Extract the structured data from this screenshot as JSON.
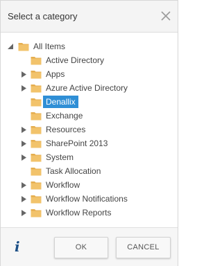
{
  "dialog": {
    "title": "Select a category"
  },
  "tree": {
    "root": {
      "label": "All Items",
      "expanded": true
    },
    "items": [
      {
        "label": "Active Directory",
        "expandable": false,
        "selected": false
      },
      {
        "label": "Apps",
        "expandable": true,
        "selected": false
      },
      {
        "label": "Azure Active Directory",
        "expandable": true,
        "selected": false
      },
      {
        "label": "Denallix",
        "expandable": false,
        "selected": true
      },
      {
        "label": "Exchange",
        "expandable": false,
        "selected": false
      },
      {
        "label": "Resources",
        "expandable": true,
        "selected": false
      },
      {
        "label": "SharePoint 2013",
        "expandable": true,
        "selected": false
      },
      {
        "label": "System",
        "expandable": true,
        "selected": false
      },
      {
        "label": "Task Allocation",
        "expandable": false,
        "selected": false
      },
      {
        "label": "Workflow",
        "expandable": true,
        "selected": false
      },
      {
        "label": "Workflow Notifications",
        "expandable": true,
        "selected": false
      },
      {
        "label": "Workflow Reports",
        "expandable": true,
        "selected": false
      }
    ]
  },
  "footer": {
    "info_glyph": "i",
    "ok_label": "OK",
    "cancel_label": "CANCEL"
  },
  "colors": {
    "folder": "#f2c36b",
    "folder_tab": "#e5ae4f",
    "selection": "#2f8fd6",
    "info": "#1c4f86",
    "twisty": "#666666"
  },
  "icons": {
    "close": "close-icon",
    "folder": "folder-icon",
    "info": "info-icon",
    "expand": "expand-arrow-icon",
    "collapse": "collapse-arrow-icon"
  }
}
